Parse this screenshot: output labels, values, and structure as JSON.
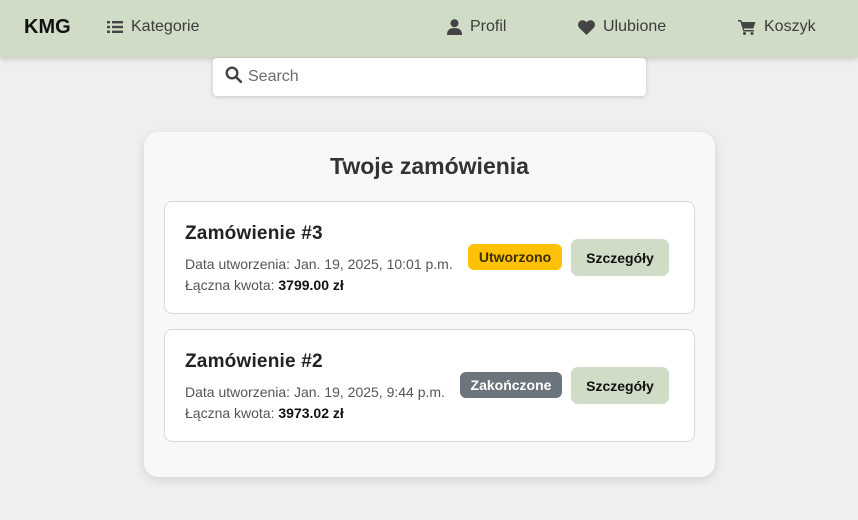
{
  "navbar": {
    "brand": "KMG",
    "categories_label": "Kategorie",
    "profile_label": "Profil",
    "favorites_label": "Ulubione",
    "cart_label": "Koszyk"
  },
  "search": {
    "placeholder": "Search"
  },
  "orders_panel": {
    "title": "Twoje zamówienia",
    "orders": [
      {
        "title": "Zamówienie #3",
        "date_prefix": "Data utworzenia: ",
        "date": "Jan. 19, 2025, 10:01 p.m.",
        "total_prefix": "Łączna kwota: ",
        "total": "3799.00 zł",
        "status": "Utworzono",
        "status_color": "#ffc107",
        "details_label": "Szczegóły"
      },
      {
        "title": "Zamówienie #2",
        "date_prefix": "Data utworzenia: ",
        "date": "Jan. 19, 2025, 9:44 p.m.",
        "total_prefix": "Łączna kwota: ",
        "total": "3973.02 zł",
        "status": "Zakończone",
        "status_color": "#6c757d",
        "details_label": "Szczegóły"
      }
    ]
  },
  "colors": {
    "navbar_bg": "#d0dcc5",
    "page_bg": "#efefef"
  }
}
